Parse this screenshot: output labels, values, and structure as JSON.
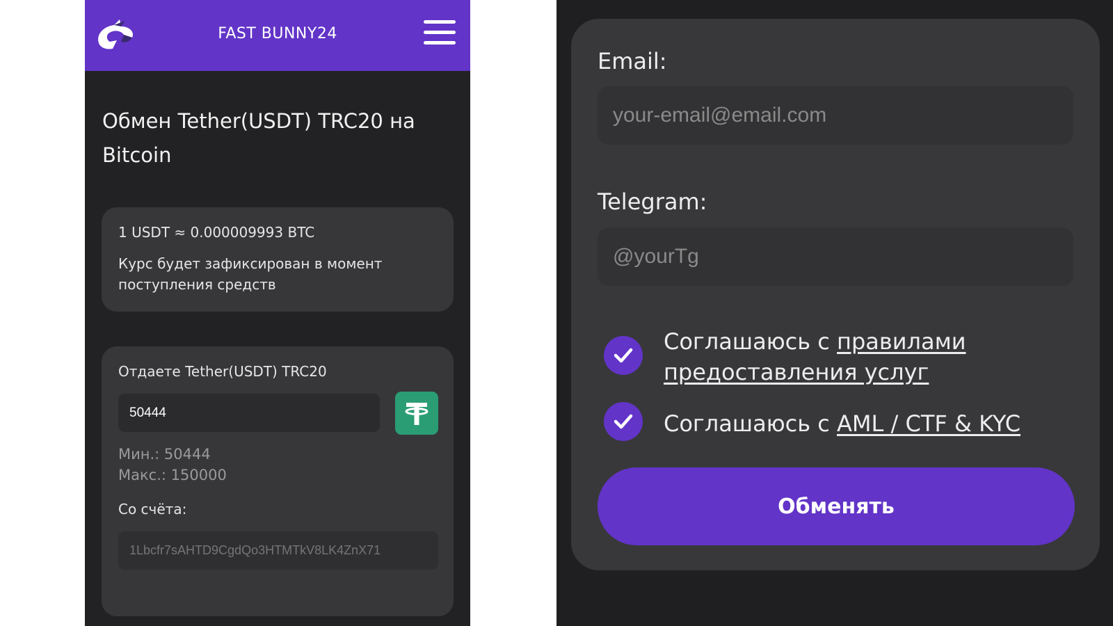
{
  "header": {
    "brand": "FAST BUNNY24"
  },
  "page": {
    "title": "Обмен Tether(USDT) TRC20 на Bitcoin"
  },
  "rate": {
    "line": "1 USDT ≈ 0.000009993 BTC",
    "note": "Курс будет зафиксирован в момент поступления средств"
  },
  "give": {
    "label": "Отдаете Tether(USDT) TRC20",
    "amount": "50444",
    "min": "Мин.: 50444",
    "max": "Макс.: 150000",
    "account_label": "Со счёта:",
    "account_placeholder": "1Lbcfr7sAHTD9CgdQo3HTMTkV8LK4ZnX71",
    "coin_icon": "tether-icon",
    "coin_color": "#2a9d74"
  },
  "form": {
    "email_label": "Email:",
    "email_placeholder": "your-email@email.com",
    "telegram_label": "Telegram:",
    "telegram_placeholder": "@yourTg",
    "agree_prefix": "Соглашаюсь с ",
    "agree_rules_link": "правилами предоставления услуг",
    "agree_aml_link": "AML / CTF & KYC",
    "submit_label": "Обменять"
  },
  "colors": {
    "accent": "#6234c8",
    "background": "#222224",
    "card": "#37373a"
  }
}
